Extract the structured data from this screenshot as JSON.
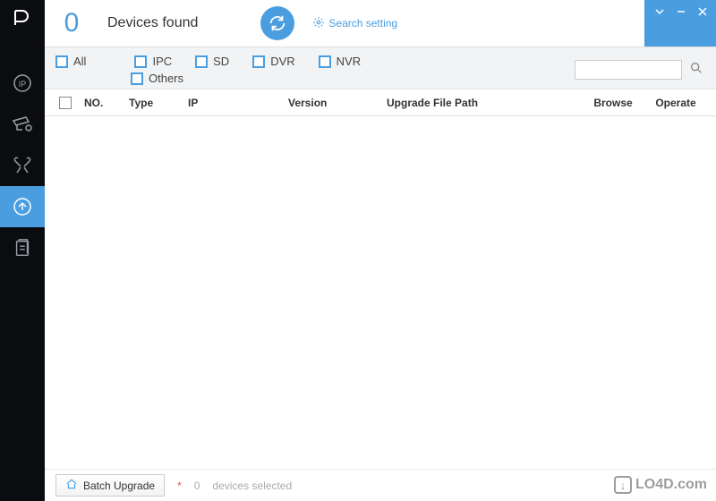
{
  "header": {
    "device_count": "0",
    "found_label": "Devices found",
    "search_setting": "Search setting"
  },
  "filters": {
    "all": "All",
    "ipc": "IPC",
    "sd": "SD",
    "dvr": "DVR",
    "nvr": "NVR",
    "others": "Others",
    "search_value": ""
  },
  "table": {
    "col_no": "NO.",
    "col_type": "Type",
    "col_ip": "IP",
    "col_version": "Version",
    "col_path": "Upgrade File Path",
    "col_browse": "Browse",
    "col_operate": "Operate"
  },
  "footer": {
    "batch_upgrade": "Batch Upgrade",
    "star": "*",
    "selected_count": "0",
    "selected_label": "devices selected"
  },
  "watermark": "LO4D.com"
}
